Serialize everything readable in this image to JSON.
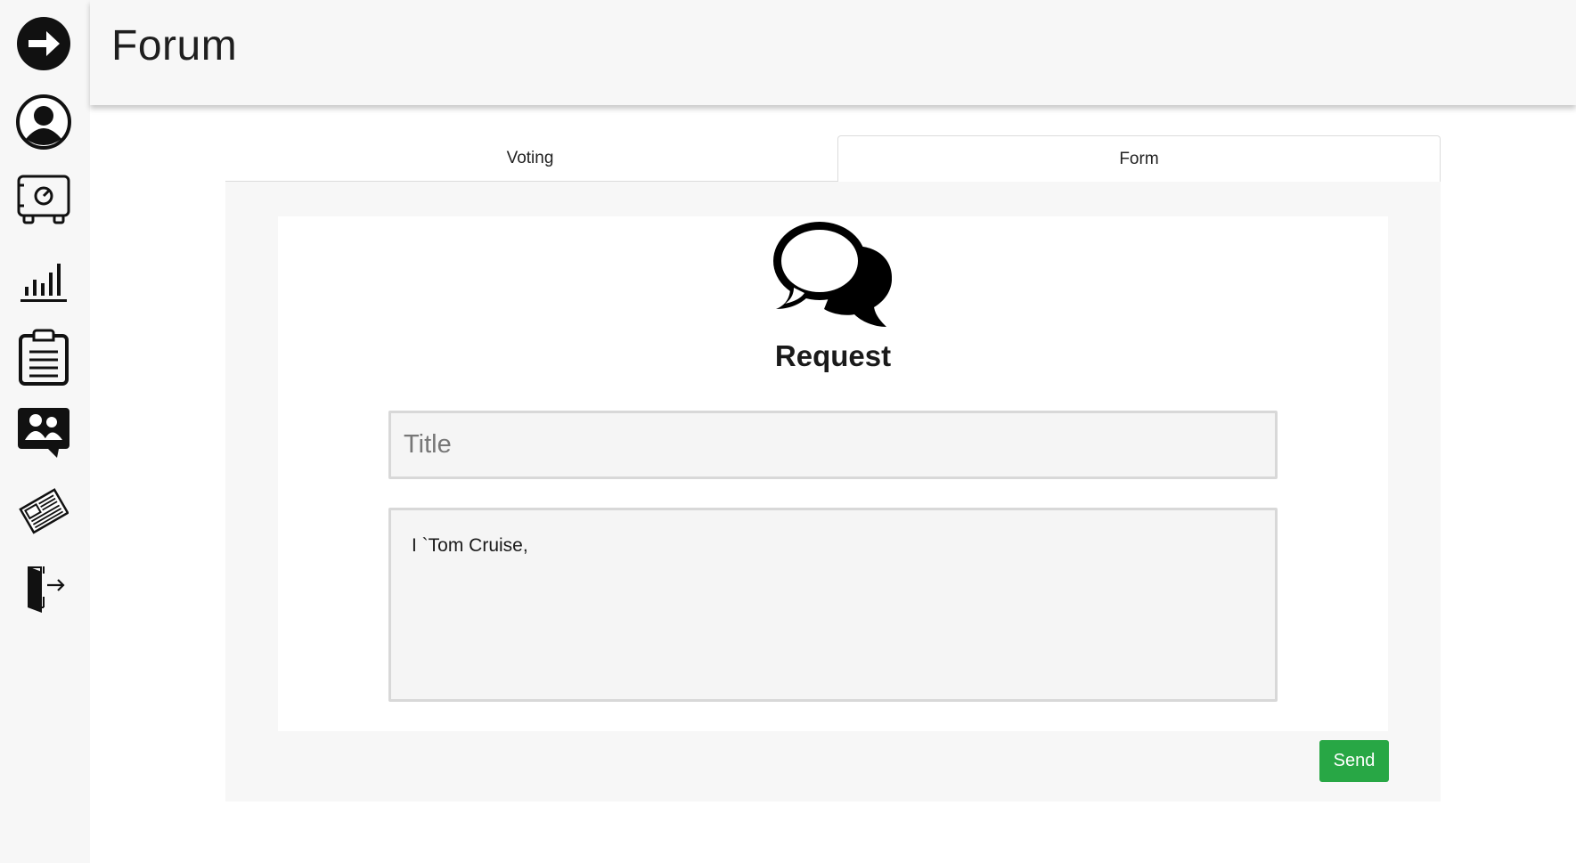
{
  "header": {
    "title": "Forum"
  },
  "sidebar": {
    "items": [
      {
        "icon": "arrow-right-circle-icon"
      },
      {
        "icon": "user-profile-icon"
      },
      {
        "icon": "safe-vault-icon"
      },
      {
        "icon": "bar-chart-icon"
      },
      {
        "icon": "clipboard-list-icon"
      },
      {
        "icon": "group-chat-icon"
      },
      {
        "icon": "newspaper-icon"
      },
      {
        "icon": "logout-door-icon"
      }
    ]
  },
  "tabs": [
    {
      "label": "Voting",
      "active": false
    },
    {
      "label": "Form",
      "active": true
    }
  ],
  "form": {
    "icon": "speech-bubbles-icon",
    "heading": "Request",
    "title_placeholder": "Title",
    "title_value": "",
    "body_value": "I `Tom Cruise,",
    "send_label": "Send"
  },
  "colors": {
    "send_button": "#28a745",
    "background": "#f7f7f7",
    "card": "#ffffff"
  }
}
